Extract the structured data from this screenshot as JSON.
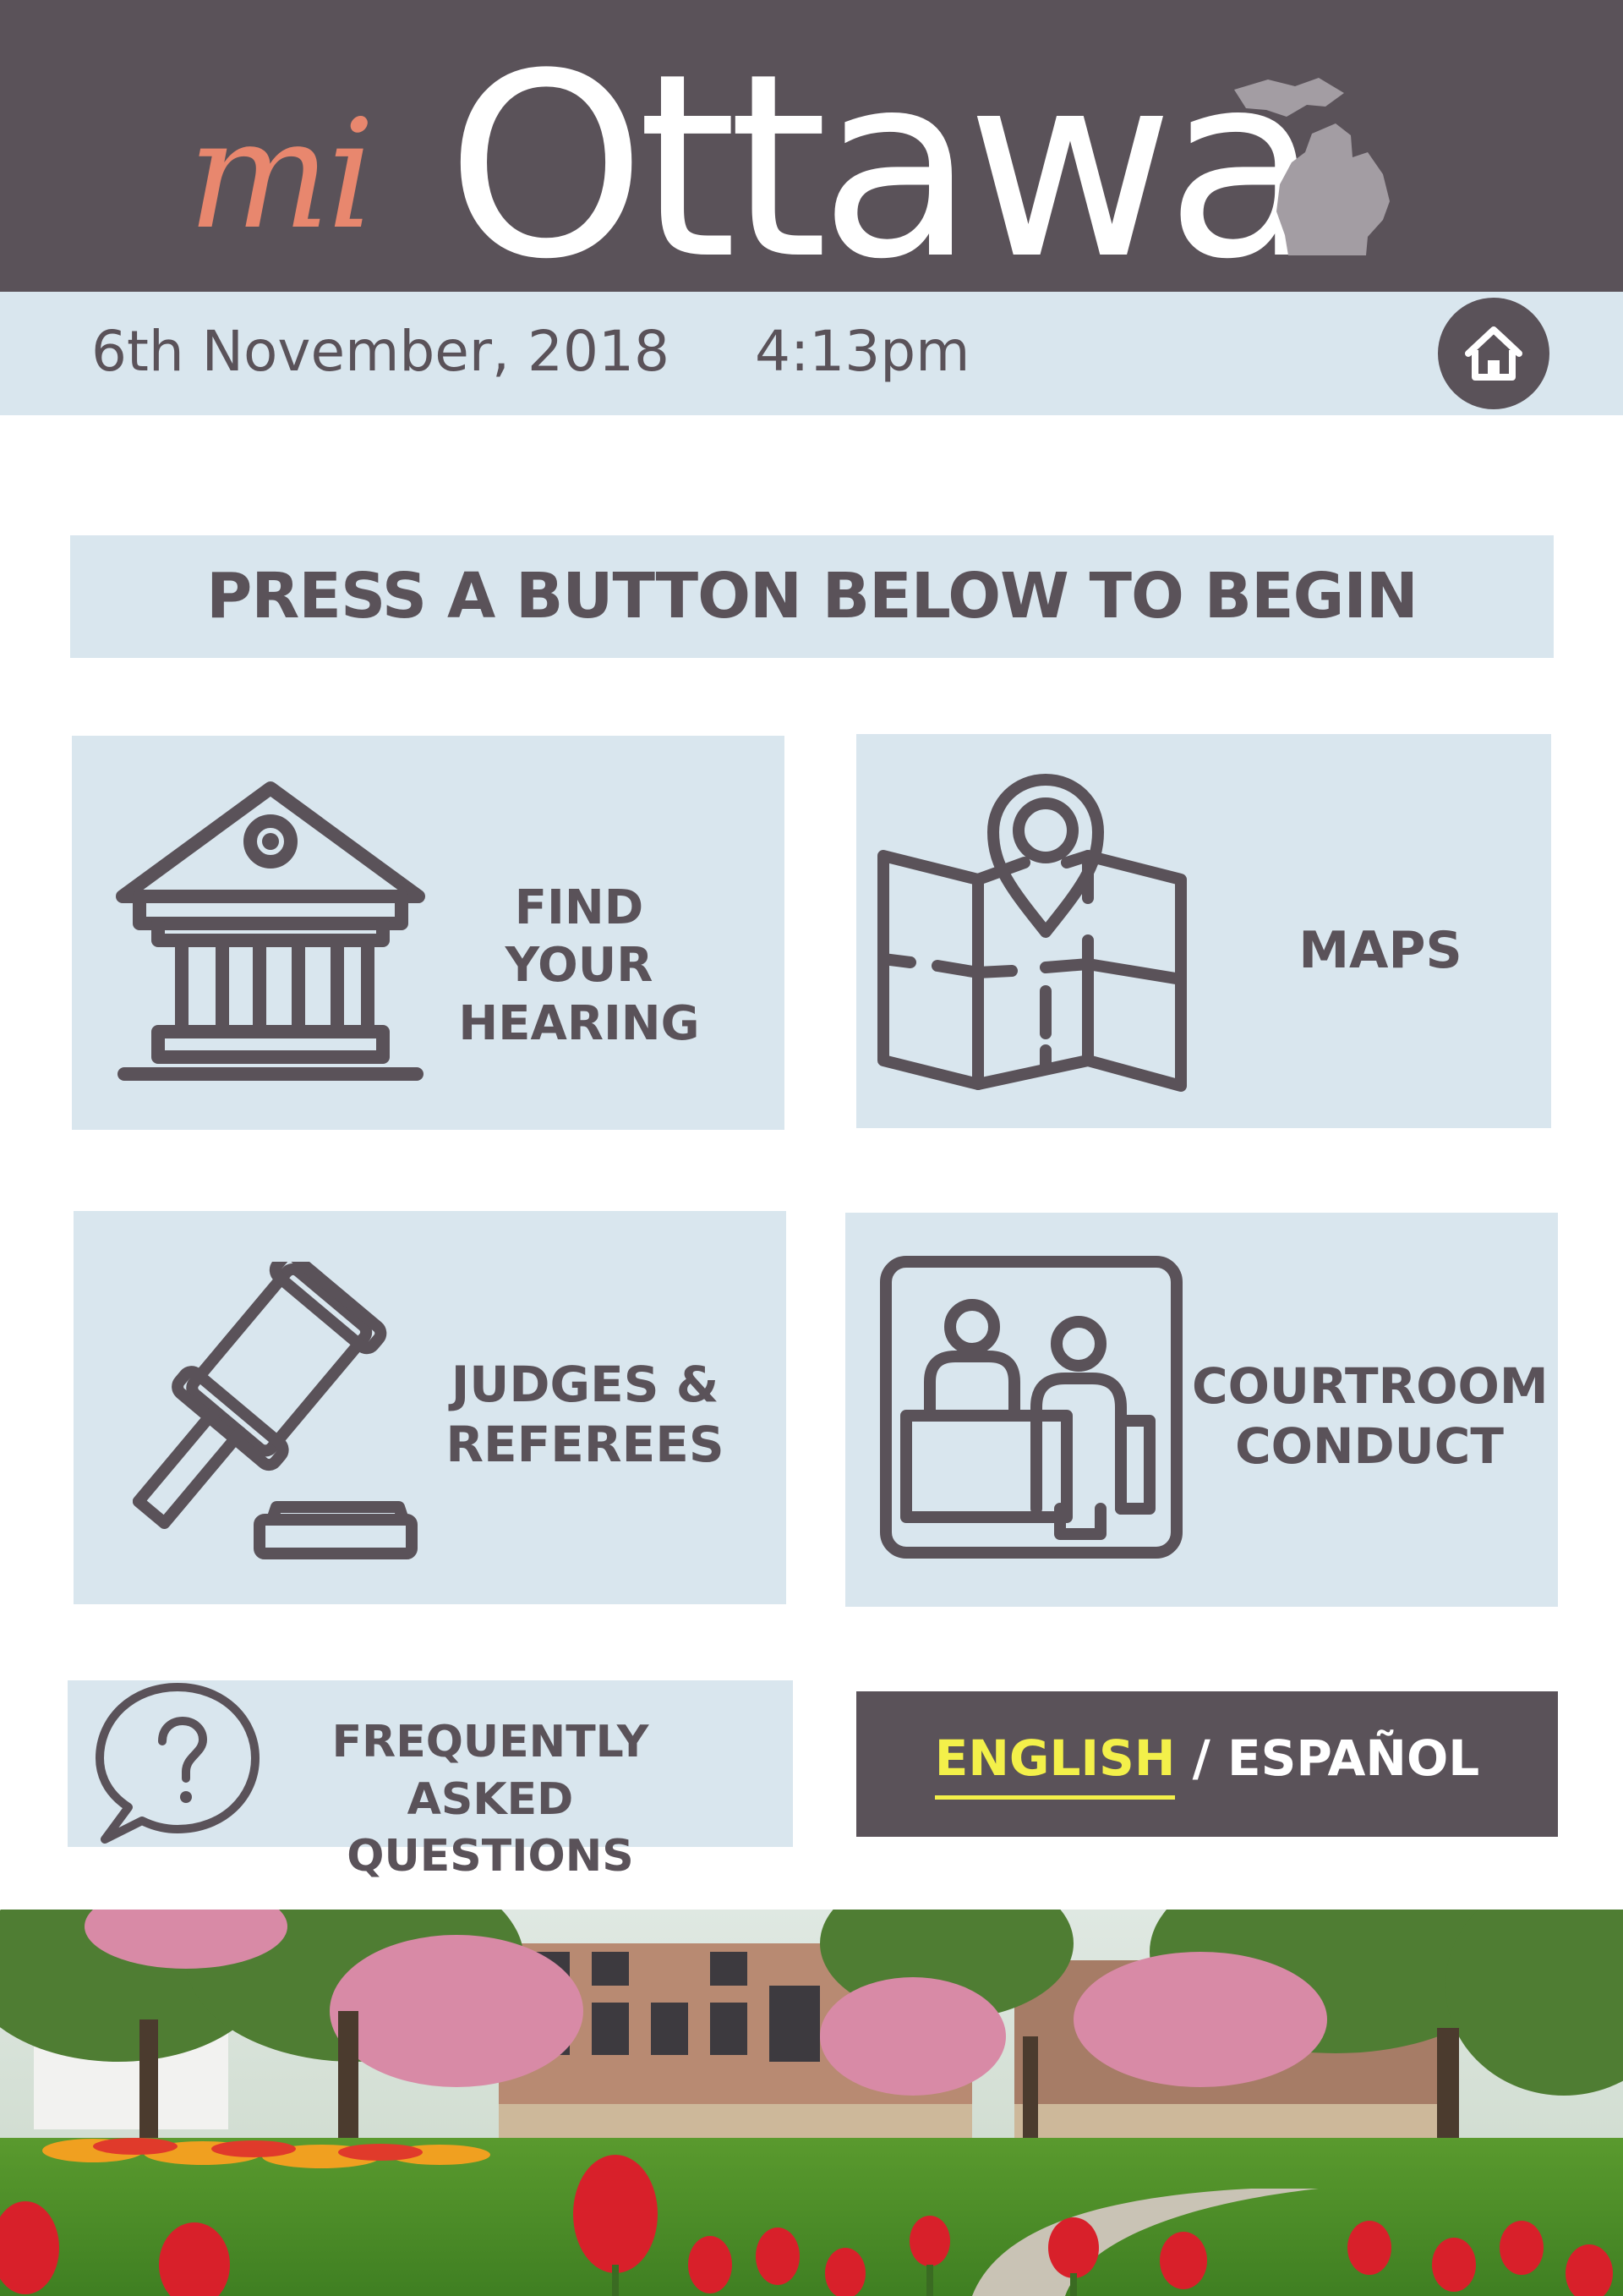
{
  "header": {
    "logo_prefix": "mi",
    "logo_name": "Ottawa"
  },
  "status_bar": {
    "date": "6th November, 2018",
    "time": "4:13pm",
    "home_icon": "home-icon"
  },
  "banner": {
    "text": "PRESS A BUTTON BELOW TO BEGIN"
  },
  "tiles": {
    "find_hearing": {
      "line1": "FIND YOUR",
      "line2": "HEARING",
      "icon": "courthouse-icon"
    },
    "maps": {
      "label": "MAPS",
      "icon": "map-pin-icon"
    },
    "judges": {
      "line1": "JUDGES &",
      "line2": "REFEREES",
      "icon": "gavel-icon"
    },
    "conduct": {
      "line1": "COURTROOM",
      "line2": "CONDUCT",
      "icon": "courtroom-people-icon"
    },
    "faq": {
      "line1": "FREQUENTLY",
      "line2": "ASKED QUESTIONS",
      "icon": "question-bubble-icon"
    }
  },
  "language": {
    "english": "ENGLISH",
    "separator": " / ",
    "spanish": "ESPAÑOL"
  },
  "colors": {
    "dark": "#5a5259",
    "light_blue": "#d9e6ee",
    "accent_coral": "#e8876e",
    "accent_yellow": "#f3f04a"
  }
}
